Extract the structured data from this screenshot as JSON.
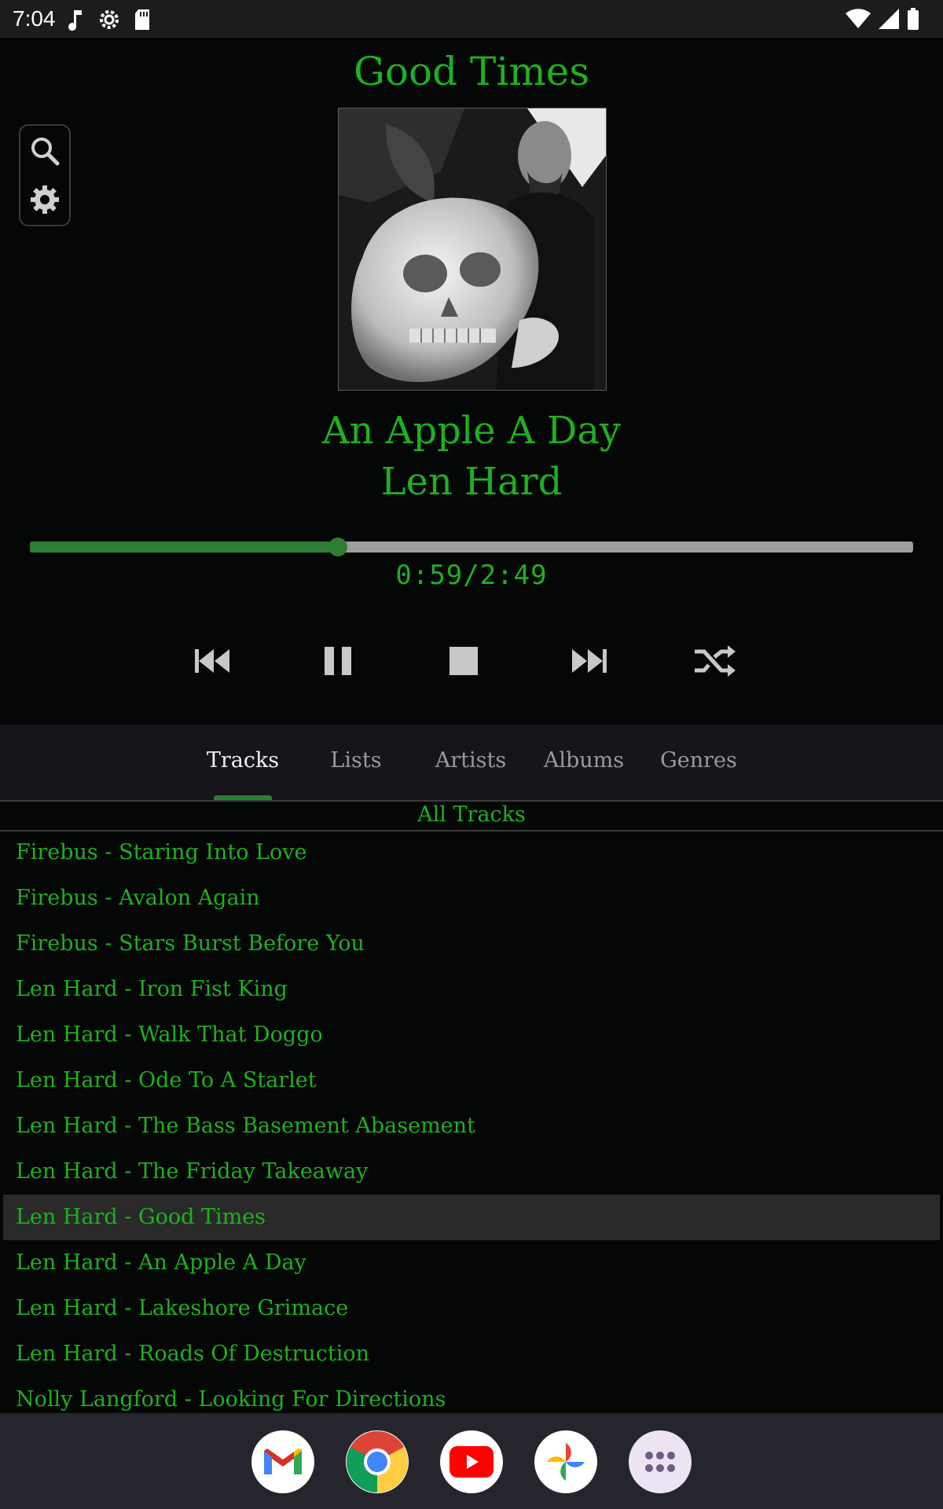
{
  "status_bar": {
    "time": "7:04",
    "left_icons": [
      "music-note-icon",
      "settings-icon",
      "sd-card-icon"
    ],
    "right_icons": [
      "wifi-icon",
      "signal-icon",
      "battery-icon"
    ]
  },
  "album_title": "Good Times",
  "side_controls": [
    "search-icon",
    "gear-icon"
  ],
  "now_playing": {
    "title": "An Apple A Day",
    "artist": "Len Hard",
    "time_readout": "0:59/2:49",
    "progress_fraction": 0.349
  },
  "transport": [
    "previous-icon",
    "pause-icon",
    "stop-icon",
    "next-icon",
    "shuffle-icon"
  ],
  "tabs": [
    {
      "label": "Tracks",
      "active": true
    },
    {
      "label": "Lists",
      "active": false
    },
    {
      "label": "Artists",
      "active": false
    },
    {
      "label": "Albums",
      "active": false
    },
    {
      "label": "Genres",
      "active": false
    }
  ],
  "list_header": "All Tracks",
  "tracks": [
    "Firebus - Staring Into Love",
    "Firebus - Avalon Again",
    "Firebus - Stars Burst Before You",
    "Len Hard - Iron Fist King",
    "Len Hard - Walk That Doggo",
    "Len Hard - Ode To A Starlet",
    "Len Hard - The Bass Basement Abasement",
    "Len Hard - The Friday Takeaway",
    "Len Hard - Good Times",
    "Len Hard - An Apple A Day",
    "Len Hard - Lakeshore Grimace",
    "Len Hard - Roads Of Destruction",
    "Nolly Langford - Looking For Directions"
  ],
  "selected_track_index": 8,
  "dock_apps": [
    "gmail-icon",
    "chrome-icon",
    "youtube-icon",
    "photos-icon",
    "app-drawer-icon"
  ],
  "colors": {
    "accent_green": "#1fb01f",
    "progress_green": "#2e7d32",
    "background": "#050707"
  }
}
